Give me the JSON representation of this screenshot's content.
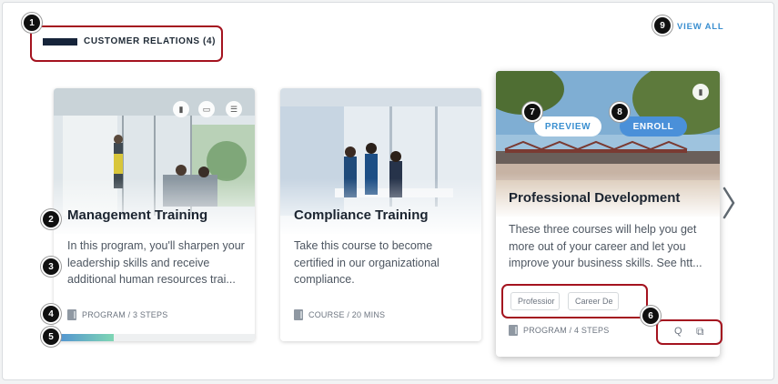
{
  "section": {
    "title": "CUSTOMER RELATIONS (4)",
    "view_all": "VIEW ALL"
  },
  "badges": [
    "1",
    "2",
    "3",
    "4",
    "5",
    "6",
    "7",
    "8",
    "9"
  ],
  "cards": [
    {
      "title": "Management Training",
      "description": "In this program, you'll sharpen your leadership skills and receive additional human resources trai...",
      "meta": "PROGRAM / 3 STEPS",
      "progress": 0.3
    },
    {
      "title": "Compliance Training",
      "description": "Take this course to become certified in our organizational compliance.",
      "meta": "COURSE / 20 MINS"
    },
    {
      "title": "Professional Development",
      "description": "These three courses will help you get more out of your career and let you improve your business skills. See htt...",
      "meta": "PROGRAM / 4 STEPS",
      "preview_label": "PREVIEW",
      "enroll_label": "ENROLL",
      "tags": [
        "Professior",
        "Career De"
      ],
      "action_icons": [
        "Q",
        "⧉"
      ]
    }
  ],
  "colors": {
    "accent": "#3a8fd0",
    "highlight": "#a4131f",
    "enroll": "#4a90d9"
  }
}
